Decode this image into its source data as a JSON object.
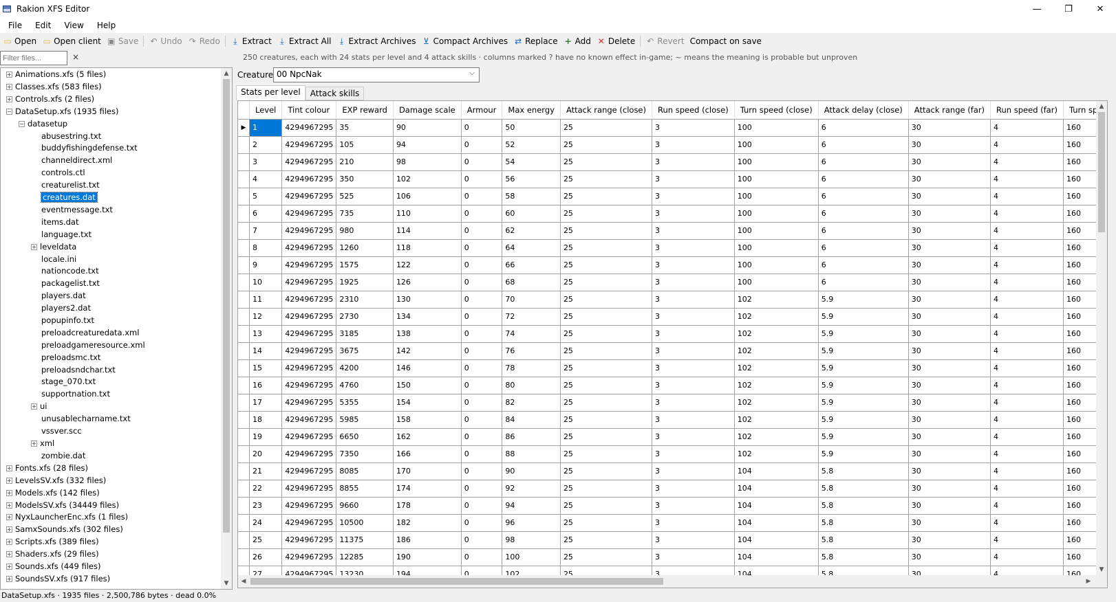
{
  "window": {
    "title": "Rakion XFS Editor",
    "minimize": "—",
    "maximize": "❐",
    "close": "✕"
  },
  "menu": [
    "File",
    "Edit",
    "View",
    "Help"
  ],
  "toolbar": {
    "open": "Open",
    "open_client": "Open client",
    "save": "Save",
    "undo": "Undo",
    "redo": "Redo",
    "extract": "Extract",
    "extract_all": "Extract All",
    "extract_archives": "Extract Archives",
    "compact_archives": "Compact Archives",
    "replace": "Replace",
    "add": "Add",
    "delete": "Delete",
    "revert": "Revert",
    "compact_on_save": "Compact on save"
  },
  "filter": {
    "placeholder": "Filter files...",
    "clear": "×"
  },
  "info_text": "250 creatures, each with 24 stats per level and 4 attack skills  ·  columns marked ? have no known effect in-game; ~ means the meaning is probable but unproven",
  "tree": [
    {
      "label": "Animations.xfs  (5 files)",
      "level": 0,
      "exp": "+"
    },
    {
      "label": "Classes.xfs  (583 files)",
      "level": 0,
      "exp": "+"
    },
    {
      "label": "Controls.xfs  (2 files)",
      "level": 0,
      "exp": "+"
    },
    {
      "label": "DataSetup.xfs  (1935 files)",
      "level": 0,
      "exp": "−"
    },
    {
      "label": "datasetup",
      "level": 1,
      "exp": "−"
    },
    {
      "label": "abusestring.txt",
      "level": 2,
      "exp": ""
    },
    {
      "label": "buddyfishingdefense.txt",
      "level": 2,
      "exp": ""
    },
    {
      "label": "channeldirect.xml",
      "level": 2,
      "exp": ""
    },
    {
      "label": "controls.ctl",
      "level": 2,
      "exp": ""
    },
    {
      "label": "creaturelist.txt",
      "level": 2,
      "exp": ""
    },
    {
      "label": "creatures.dat",
      "level": 2,
      "exp": "",
      "selected": true
    },
    {
      "label": "eventmessage.txt",
      "level": 2,
      "exp": ""
    },
    {
      "label": "items.dat",
      "level": 2,
      "exp": ""
    },
    {
      "label": "language.txt",
      "level": 2,
      "exp": ""
    },
    {
      "label": "leveldata",
      "level": 2,
      "exp": "+"
    },
    {
      "label": "locale.ini",
      "level": 2,
      "exp": ""
    },
    {
      "label": "nationcode.txt",
      "level": 2,
      "exp": ""
    },
    {
      "label": "packagelist.txt",
      "level": 2,
      "exp": ""
    },
    {
      "label": "players.dat",
      "level": 2,
      "exp": ""
    },
    {
      "label": "players2.dat",
      "level": 2,
      "exp": ""
    },
    {
      "label": "popupinfo.txt",
      "level": 2,
      "exp": ""
    },
    {
      "label": "preloadcreaturedata.xml",
      "level": 2,
      "exp": ""
    },
    {
      "label": "preloadgameresource.xml",
      "level": 2,
      "exp": ""
    },
    {
      "label": "preloadsmc.txt",
      "level": 2,
      "exp": ""
    },
    {
      "label": "preloadsndchar.txt",
      "level": 2,
      "exp": ""
    },
    {
      "label": "stage_070.txt",
      "level": 2,
      "exp": ""
    },
    {
      "label": "supportnation.txt",
      "level": 2,
      "exp": ""
    },
    {
      "label": "ui",
      "level": 2,
      "exp": "+"
    },
    {
      "label": "unusablecharname.txt",
      "level": 2,
      "exp": ""
    },
    {
      "label": "vssver.scc",
      "level": 2,
      "exp": ""
    },
    {
      "label": "xml",
      "level": 2,
      "exp": "+"
    },
    {
      "label": "zombie.dat",
      "level": 2,
      "exp": ""
    },
    {
      "label": "Fonts.xfs  (28 files)",
      "level": 0,
      "exp": "+"
    },
    {
      "label": "LevelsSV.xfs  (332 files)",
      "level": 0,
      "exp": "+"
    },
    {
      "label": "Models.xfs  (142 files)",
      "level": 0,
      "exp": "+"
    },
    {
      "label": "ModelsSV.xfs  (34449 files)",
      "level": 0,
      "exp": "+"
    },
    {
      "label": "NyxLauncherEnc.xfs  (1 files)",
      "level": 0,
      "exp": "+"
    },
    {
      "label": "SamxSounds.xfs  (302 files)",
      "level": 0,
      "exp": "+"
    },
    {
      "label": "Scripts.xfs  (389 files)",
      "level": 0,
      "exp": "+"
    },
    {
      "label": "Shaders.xfs  (29 files)",
      "level": 0,
      "exp": "+"
    },
    {
      "label": "Sounds.xfs  (449 files)",
      "level": 0,
      "exp": "+"
    },
    {
      "label": "SoundsSV.xfs  (917 files)",
      "level": 0,
      "exp": "+"
    }
  ],
  "creature": {
    "label": "Creature:",
    "value": "00  NpcNak"
  },
  "tabs": [
    "Stats per level",
    "Attack skills"
  ],
  "grid": {
    "columns": [
      "Level",
      "Tint colour",
      "EXP reward",
      "Damage scale",
      "Armour",
      "Max energy",
      "Attack range (close)",
      "Run speed (close)",
      "Turn speed (close)",
      "Attack delay (close)",
      "Attack range (far)",
      "Run speed (far)",
      "Turn speed"
    ],
    "rows": [
      [
        "1",
        "4294967295",
        "35",
        "90",
        "0",
        "50",
        "25",
        "3",
        "100",
        "6",
        "30",
        "4",
        "160"
      ],
      [
        "2",
        "4294967295",
        "105",
        "94",
        "0",
        "52",
        "25",
        "3",
        "100",
        "6",
        "30",
        "4",
        "160"
      ],
      [
        "3",
        "4294967295",
        "210",
        "98",
        "0",
        "54",
        "25",
        "3",
        "100",
        "6",
        "30",
        "4",
        "160"
      ],
      [
        "4",
        "4294967295",
        "350",
        "102",
        "0",
        "56",
        "25",
        "3",
        "100",
        "6",
        "30",
        "4",
        "160"
      ],
      [
        "5",
        "4294967295",
        "525",
        "106",
        "0",
        "58",
        "25",
        "3",
        "100",
        "6",
        "30",
        "4",
        "160"
      ],
      [
        "6",
        "4294967295",
        "735",
        "110",
        "0",
        "60",
        "25",
        "3",
        "100",
        "6",
        "30",
        "4",
        "160"
      ],
      [
        "7",
        "4294967295",
        "980",
        "114",
        "0",
        "62",
        "25",
        "3",
        "100",
        "6",
        "30",
        "4",
        "160"
      ],
      [
        "8",
        "4294967295",
        "1260",
        "118",
        "0",
        "64",
        "25",
        "3",
        "100",
        "6",
        "30",
        "4",
        "160"
      ],
      [
        "9",
        "4294967295",
        "1575",
        "122",
        "0",
        "66",
        "25",
        "3",
        "100",
        "6",
        "30",
        "4",
        "160"
      ],
      [
        "10",
        "4294967295",
        "1925",
        "126",
        "0",
        "68",
        "25",
        "3",
        "100",
        "6",
        "30",
        "4",
        "160"
      ],
      [
        "11",
        "4294967295",
        "2310",
        "130",
        "0",
        "70",
        "25",
        "3",
        "102",
        "5.9",
        "30",
        "4",
        "160"
      ],
      [
        "12",
        "4294967295",
        "2730",
        "134",
        "0",
        "72",
        "25",
        "3",
        "102",
        "5.9",
        "30",
        "4",
        "160"
      ],
      [
        "13",
        "4294967295",
        "3185",
        "138",
        "0",
        "74",
        "25",
        "3",
        "102",
        "5.9",
        "30",
        "4",
        "160"
      ],
      [
        "14",
        "4294967295",
        "3675",
        "142",
        "0",
        "76",
        "25",
        "3",
        "102",
        "5.9",
        "30",
        "4",
        "160"
      ],
      [
        "15",
        "4294967295",
        "4200",
        "146",
        "0",
        "78",
        "25",
        "3",
        "102",
        "5.9",
        "30",
        "4",
        "160"
      ],
      [
        "16",
        "4294967295",
        "4760",
        "150",
        "0",
        "80",
        "25",
        "3",
        "102",
        "5.9",
        "30",
        "4",
        "160"
      ],
      [
        "17",
        "4294967295",
        "5355",
        "154",
        "0",
        "82",
        "25",
        "3",
        "102",
        "5.9",
        "30",
        "4",
        "160"
      ],
      [
        "18",
        "4294967295",
        "5985",
        "158",
        "0",
        "84",
        "25",
        "3",
        "102",
        "5.9",
        "30",
        "4",
        "160"
      ],
      [
        "19",
        "4294967295",
        "6650",
        "162",
        "0",
        "86",
        "25",
        "3",
        "102",
        "5.9",
        "30",
        "4",
        "160"
      ],
      [
        "20",
        "4294967295",
        "7350",
        "166",
        "0",
        "88",
        "25",
        "3",
        "102",
        "5.9",
        "30",
        "4",
        "160"
      ],
      [
        "21",
        "4294967295",
        "8085",
        "170",
        "0",
        "90",
        "25",
        "3",
        "104",
        "5.8",
        "30",
        "4",
        "160"
      ],
      [
        "22",
        "4294967295",
        "8855",
        "174",
        "0",
        "92",
        "25",
        "3",
        "104",
        "5.8",
        "30",
        "4",
        "160"
      ],
      [
        "23",
        "4294967295",
        "9660",
        "178",
        "0",
        "94",
        "25",
        "3",
        "104",
        "5.8",
        "30",
        "4",
        "160"
      ],
      [
        "24",
        "4294967295",
        "10500",
        "182",
        "0",
        "96",
        "25",
        "3",
        "104",
        "5.8",
        "30",
        "4",
        "160"
      ],
      [
        "25",
        "4294967295",
        "11375",
        "186",
        "0",
        "98",
        "25",
        "3",
        "104",
        "5.8",
        "30",
        "4",
        "160"
      ],
      [
        "26",
        "4294967295",
        "12285",
        "190",
        "0",
        "100",
        "25",
        "3",
        "104",
        "5.8",
        "30",
        "4",
        "160"
      ],
      [
        "27",
        "4294967295",
        "13230",
        "194",
        "0",
        "102",
        "25",
        "3",
        "104",
        "5.8",
        "30",
        "4",
        "160"
      ]
    ],
    "selected_row_marker": "▶"
  },
  "status": "DataSetup.xfs  ·  1935 files · 2,500,786 bytes · dead 0.0%",
  "colors": {
    "selection": "#0078d7",
    "delete_icon": "#d32f2f",
    "add_icon": "#2e7d32",
    "folder_icon": "#e8b64a"
  }
}
